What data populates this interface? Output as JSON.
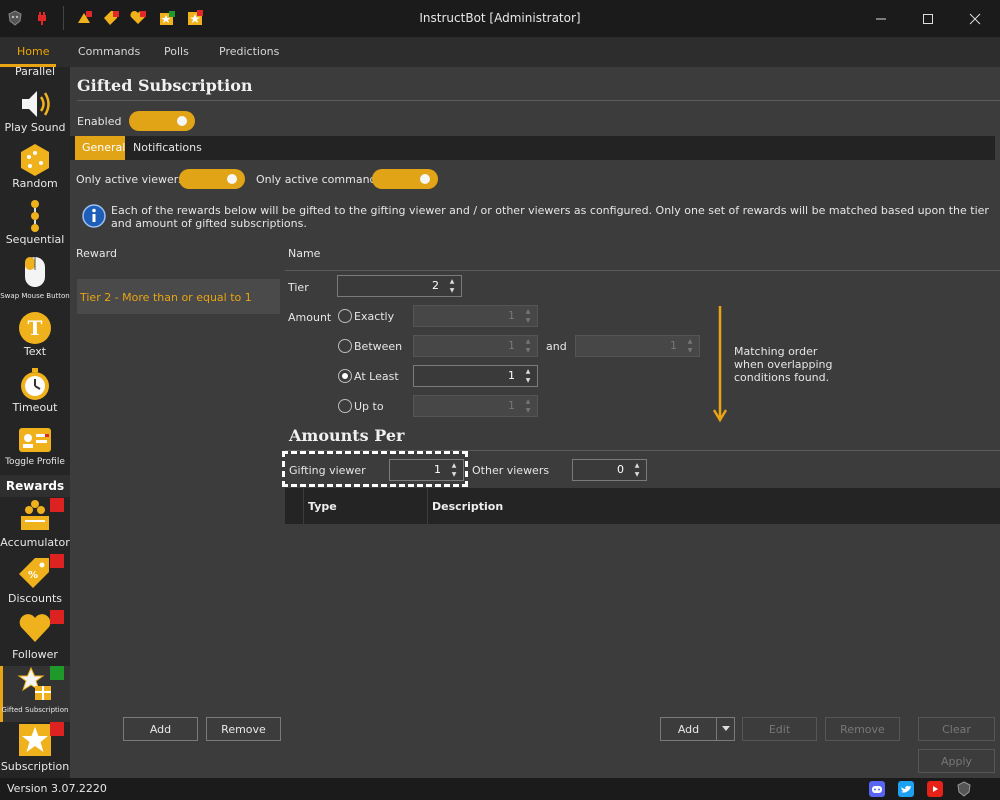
{
  "window": {
    "title": "InstructBot [Administrator]"
  },
  "menu": {
    "items": [
      "Home",
      "Commands",
      "Polls",
      "Predictions"
    ],
    "active": "Home"
  },
  "sidebar": {
    "items": [
      {
        "label": "Parallel",
        "icon": "parallel-icon"
      },
      {
        "label": "Play Sound",
        "icon": "speaker-icon"
      },
      {
        "label": "Random",
        "icon": "dice-icon"
      },
      {
        "label": "Sequential",
        "icon": "sequence-icon"
      },
      {
        "label": "Swap Mouse Button",
        "icon": "mouse-icon"
      },
      {
        "label": "Text",
        "icon": "text-icon"
      },
      {
        "label": "Timeout",
        "icon": "stopwatch-icon"
      },
      {
        "label": "Toggle Profile",
        "icon": "profile-card-icon"
      }
    ],
    "rewards_header": "Rewards",
    "reward_items": [
      {
        "label": "Accumulator",
        "icon": "accumulator-icon",
        "flag": "#dd2222"
      },
      {
        "label": "Discounts",
        "icon": "discount-tag-icon",
        "flag": "#dd2222"
      },
      {
        "label": "Follower",
        "icon": "heart-icon",
        "flag": "#dd2222"
      },
      {
        "label": "Gifted Subscription",
        "icon": "gift-star-icon",
        "flag": "#1f9a2a"
      },
      {
        "label": "Subscription",
        "icon": "star-icon",
        "flag": "#dd2222"
      }
    ]
  },
  "main": {
    "title": "Gifted Subscription",
    "enabled_label": "Enabled",
    "tabs": [
      "General",
      "Notifications"
    ],
    "only_active_viewers": "Only active viewers",
    "only_active_commands": "Only active commands",
    "info_text": "Each of the rewards below will be gifted to the gifting viewer and / or other viewers as configured. Only one set of rewards will be matched based upon the tier and amount of gifted subscriptions.",
    "reward_header": "Reward",
    "reward_rows": [
      "Tier 2 - More than or equal to 1"
    ],
    "name_label": "Name",
    "tier_label": "Tier",
    "tier_value": "2",
    "amount_label": "Amount",
    "options": {
      "exactly": {
        "label": "Exactly",
        "value": "1"
      },
      "between": {
        "label": "Between",
        "value": "1",
        "and_label": "and",
        "value2": "1"
      },
      "at_least": {
        "label": "At Least",
        "value": "1"
      },
      "up_to": {
        "label": "Up to",
        "value": "1"
      }
    },
    "selected_option": "at_least",
    "matching_note": "Matching order when overlapping conditions found.",
    "amounts_per_title": "Amounts Per",
    "gifting_viewer_label": "Gifting viewer",
    "gifting_viewer_value": "1",
    "other_viewers_label": "Other viewers",
    "other_viewers_value": "0",
    "grid_columns": [
      "Type",
      "Description"
    ],
    "left_buttons": {
      "add": "Add",
      "remove": "Remove"
    },
    "right_buttons": {
      "add": "Add",
      "edit": "Edit",
      "remove": "Remove",
      "clear": "Clear",
      "apply": "Apply"
    }
  },
  "status": {
    "version": "Version 3.07.2220"
  },
  "colors": {
    "accent": "#e2a417",
    "background": "#3c3c3c"
  }
}
